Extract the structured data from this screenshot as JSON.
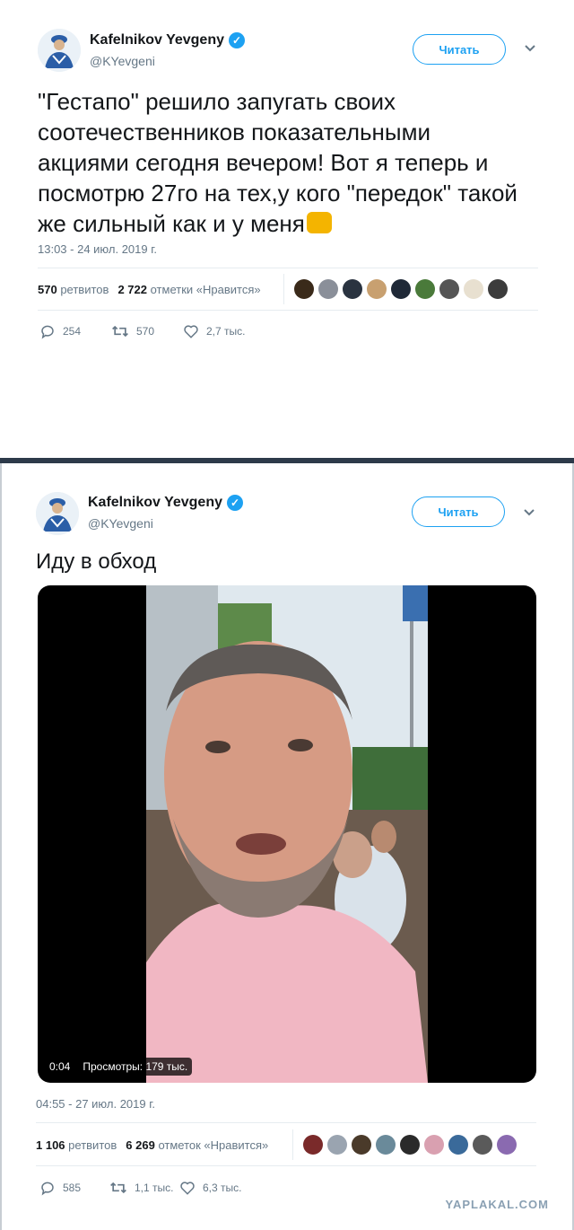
{
  "tweet1": {
    "author_name": "Kafelnikov Yevgeny",
    "author_handle": "@KYevgeni",
    "follow_label": "Читать",
    "text": "\"Гестапо\" решило запугать своих соотечественников показательными акциями сегодня вечером! Вот я теперь и посмотрю 27го на тех,у кого \"передок\" такой же сильный как и у меня",
    "emoji_icon": "raised-fist-icon",
    "timestamp": "13:03 - 24 июл. 2019 г.",
    "retweets_count": "570",
    "retweets_label": "ретвитов",
    "likes_count": "2 722",
    "likes_label": "отметки «Нравится»",
    "liker_colors": [
      "#3a2a1a",
      "#8a8f99",
      "#2a3340",
      "#c8a070",
      "#1f2937",
      "#4a7a3a",
      "#555555",
      "#e8e0d0",
      "#3c3c3c"
    ],
    "replies": "254",
    "retweets": "570",
    "likes": "2,7 тыс."
  },
  "tweet2": {
    "author_name": "Kafelnikov Yevgeny",
    "author_handle": "@KYevgeni",
    "follow_label": "Читать",
    "text": "Иду в обход",
    "video_time": "0:04",
    "video_views": "Просмотры: 179 тыс.",
    "timestamp": "04:55 - 27 июл. 2019 г.",
    "retweets_count": "1 106",
    "retweets_label": "ретвитов",
    "likes_count": "6 269",
    "likes_label": "отметок «Нравится»",
    "liker_colors": [
      "#7a2a2a",
      "#9aa4b0",
      "#4a3a2a",
      "#6a8a9a",
      "#2a2a2a",
      "#d9a0b0",
      "#3a6a9a",
      "#5a5a5a",
      "#8a6ab0"
    ],
    "replies": "585",
    "retweets": "1,1 тыс.",
    "likes": "6,3 тыс."
  },
  "watermark": "YAPLAKAL.COM",
  "colors": {
    "accent": "#1da1f2",
    "muted": "#657786",
    "text": "#14171a"
  }
}
